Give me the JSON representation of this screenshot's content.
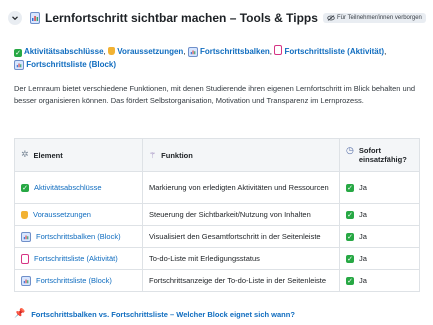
{
  "header": {
    "title": "Lernfortschritt sichtbar machen – Tools & Tipps",
    "badge": "Für Teilnehmer/innen verborgen",
    "icon": "bar-chart-icon"
  },
  "links": [
    {
      "icon": "check-icon",
      "label": "Aktivitätsabschlüsse"
    },
    {
      "icon": "lock-icon",
      "label": "Voraussetzungen"
    },
    {
      "icon": "bar-chart-icon",
      "label": "Fortschrittsbalken"
    },
    {
      "icon": "list-icon",
      "label": "Fortschrittsliste (Aktivität)"
    },
    {
      "icon": "bar-chart-icon",
      "label": "Fortschrittsliste (Block)"
    }
  ],
  "paragraph": "Der Lernraum bietet verschiedene Funktionen, mit denen Studierende ihren eigenen Lernfortschritt im Blick behalten und besser organisieren können. Das fördert Selbstorganisation, Motivation und Transparenz im Lernprozess.",
  "table": {
    "headers": [
      "Element",
      "Funktion",
      "Sofort einsatzfähig?"
    ],
    "rows": [
      {
        "element": "Aktivitätsabschlüsse",
        "icon": "check-icon",
        "funktion": "Markierung von erledigten Aktivitäten und Ressourcen",
        "sofort": "Ja"
      },
      {
        "element": "Voraussetzungen",
        "icon": "lock-icon",
        "funktion": "Steuerung der Sichtbarkeit/Nutzung von Inhalten",
        "sofort": "Ja"
      },
      {
        "element": "Fortschrittsbalken (Block)",
        "icon": "bar-chart-icon",
        "funktion": "Visualisiert den Gesamtfortschritt in der Seitenleiste",
        "sofort": "Ja"
      },
      {
        "element": "Fortschrittsliste (Aktivität)",
        "icon": "list-icon",
        "funktion": "To-do-Liste mit Erledigungsstatus",
        "sofort": "Ja"
      },
      {
        "element": "Fortschrittsliste (Block)",
        "icon": "bar-chart-icon",
        "funktion": "Fortschrittsanzeige der To-do-Liste in der Seitenleiste",
        "sofort": "Ja"
      }
    ]
  },
  "footer": {
    "text": "Fortschrittsbalken vs. Fortschrittsliste – Welcher Block eignet sich wann?"
  },
  "colors": {
    "link": "#0f6cbf",
    "check": "#27a844",
    "badge_bg": "#e9edf2"
  }
}
